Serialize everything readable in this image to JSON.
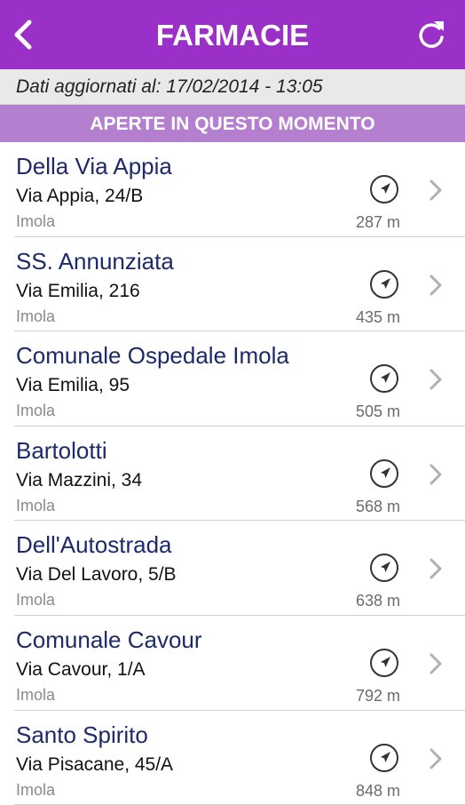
{
  "header": {
    "title": "FARMACIE",
    "back_icon": "chevron-left-icon",
    "refresh_icon": "refresh-icon"
  },
  "updated_bar": {
    "text": "Dati aggiornati al: 17/02/2014 - 13:05"
  },
  "section": {
    "label": "APERTE IN QUESTO MOMENTO"
  },
  "colors": {
    "header_bg": "#9b30c8",
    "section_bg": "#b57fcf",
    "name_text": "#1c2a6b"
  },
  "pharmacies": [
    {
      "name": "Della Via Appia",
      "address": "Via Appia, 24/B",
      "city": "Imola",
      "distance": "287 m"
    },
    {
      "name": "SS. Annunziata",
      "address": "Via Emilia, 216",
      "city": "Imola",
      "distance": "435 m"
    },
    {
      "name": "Comunale Ospedale Imola",
      "address": "Via Emilia, 95",
      "city": "Imola",
      "distance": "505 m"
    },
    {
      "name": "Bartolotti",
      "address": "Via Mazzini, 34",
      "city": "Imola",
      "distance": "568 m"
    },
    {
      "name": "Dell'Autostrada",
      "address": "Via Del Lavoro, 5/B",
      "city": "Imola",
      "distance": "638 m"
    },
    {
      "name": "Comunale Cavour",
      "address": "Via Cavour, 1/A",
      "city": "Imola",
      "distance": "792 m"
    },
    {
      "name": "Santo Spirito",
      "address": "Via Pisacane, 45/A",
      "city": "Imola",
      "distance": "848 m"
    }
  ]
}
